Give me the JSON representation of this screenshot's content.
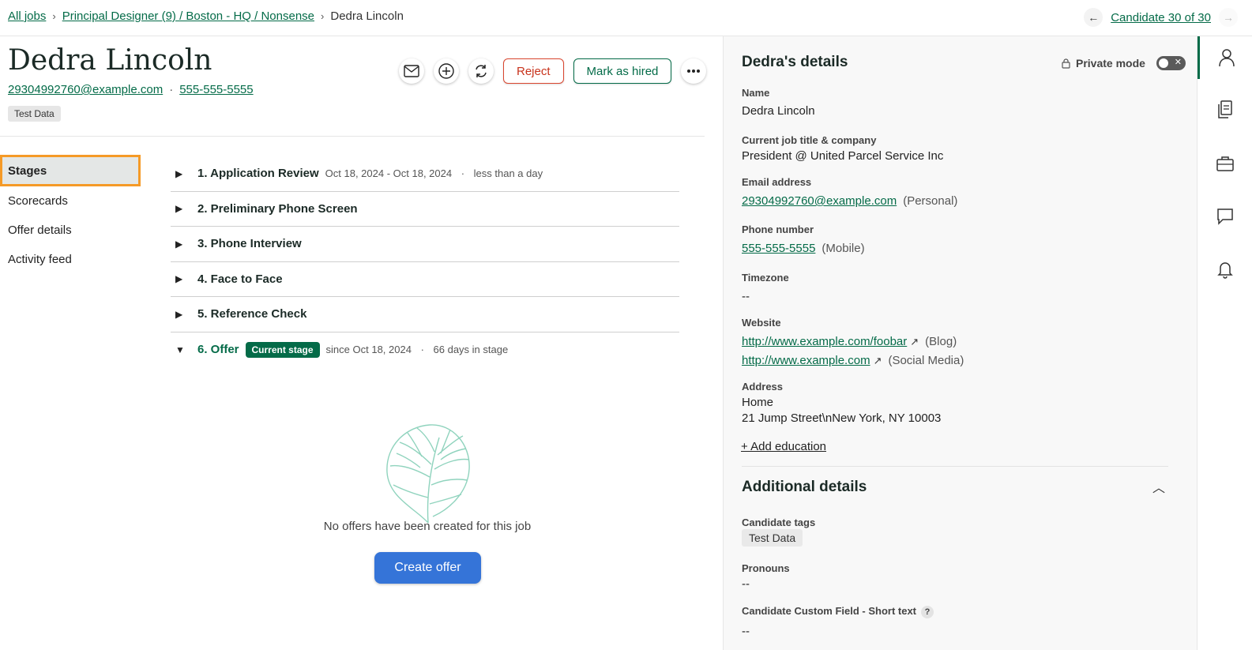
{
  "breadcrumb": {
    "all_jobs": "All jobs",
    "job": "Principal Designer (9) / Boston - HQ / Nonsense",
    "current": "Dedra Lincoln"
  },
  "candidate_nav": {
    "label": "Candidate 30 of 30"
  },
  "candidate": {
    "name": "Dedra Lincoln",
    "email": "29304992760@example.com",
    "phone": "555-555-5555",
    "tag": "Test Data"
  },
  "actions": {
    "reject": "Reject",
    "mark_hired": "Mark as hired"
  },
  "subnav": {
    "items": [
      "Stages",
      "Scorecards",
      "Offer details",
      "Activity feed"
    ]
  },
  "stages": [
    {
      "title": "1. Application Review",
      "dates": "Oct 18, 2024 - Oct 18, 2024",
      "duration": "less than a day"
    },
    {
      "title": "2. Preliminary Phone Screen"
    },
    {
      "title": "3. Phone Interview"
    },
    {
      "title": "4. Face to Face"
    },
    {
      "title": "5. Reference Check"
    },
    {
      "title": "6. Offer",
      "badge": "Current stage",
      "dates": "since Oct 18, 2024",
      "duration": "66 days in stage"
    }
  ],
  "offer": {
    "empty_text": "No offers have been created for this job",
    "create_button": "Create offer"
  },
  "details": {
    "title": "Dedra's details",
    "private_mode": "Private mode",
    "name_label": "Name",
    "name": "Dedra Lincoln",
    "job_label": "Current job title & company",
    "job": "President @ United Parcel Service Inc",
    "email_label": "Email address",
    "email": "29304992760@example.com",
    "email_type": "(Personal)",
    "phone_label": "Phone number",
    "phone": "555-555-5555",
    "phone_type": "(Mobile)",
    "timezone_label": "Timezone",
    "timezone": "--",
    "website_label": "Website",
    "website1": "http://www.example.com/foobar",
    "website1_type": "(Blog)",
    "website2": "http://www.example.com",
    "website2_type": "(Social Media)",
    "address_label": "Address",
    "address_type": "Home",
    "address": "21 Jump Street\\nNew York, NY 10003",
    "add_education": "+ Add education"
  },
  "additional": {
    "title": "Additional details",
    "tags_label": "Candidate tags",
    "tag": "Test Data",
    "pronouns_label": "Pronouns",
    "pronouns": "--",
    "custom_label": "Candidate Custom Field - Short text",
    "custom": "--",
    "help_glyph": "?"
  },
  "colors": {
    "brand_green": "#046b48",
    "reject_red": "#c8331c",
    "create_blue": "#3574d8",
    "highlight_orange": "#f59a27"
  }
}
